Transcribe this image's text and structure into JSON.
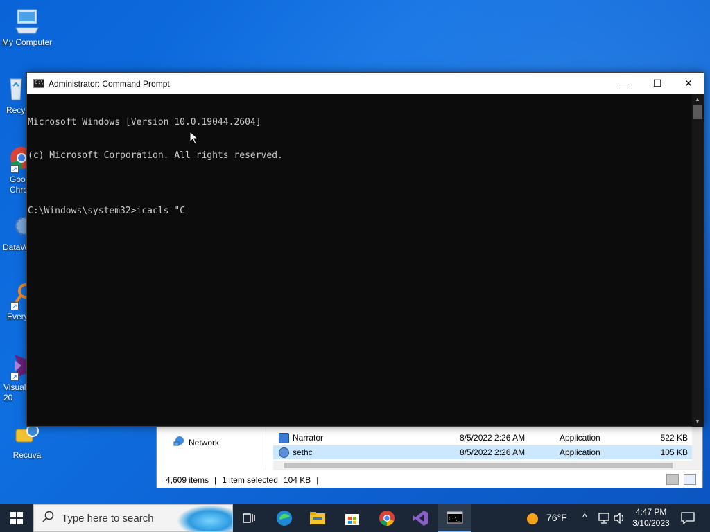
{
  "desktop": {
    "icons": [
      {
        "label": "My Computer"
      },
      {
        "label": "Recyc"
      },
      {
        "label": "Goo\nChro"
      },
      {
        "label": "DataW"
      },
      {
        "label": "Every"
      },
      {
        "label": "Visual\n20"
      },
      {
        "label": "Recuva"
      }
    ]
  },
  "cmd": {
    "title": "Administrator: Command Prompt",
    "lines": [
      "Microsoft Windows [Version 10.0.19044.2604]",
      "(c) Microsoft Corporation. All rights reserved.",
      "",
      "C:\\Windows\\system32>icacls \"C"
    ],
    "minimize_glyph": "—",
    "maximize_glyph": "☐",
    "close_glyph": "✕"
  },
  "explorer": {
    "nav_item": "Network",
    "files": [
      {
        "name": "Narrator",
        "date": "8/5/2022 2:26 AM",
        "type": "Application",
        "size": "522 KB",
        "icon": "narrator-icon"
      },
      {
        "name": "sethc",
        "date": "8/5/2022 2:26 AM",
        "type": "Application",
        "size": "105 KB",
        "icon": "gear-file-icon"
      }
    ],
    "status": {
      "items": "4,609 items",
      "selected": "1 item selected",
      "size": "104 KB"
    }
  },
  "taskbar": {
    "search_placeholder": "Type here to search",
    "weather": "76°F",
    "time": "4:47 PM",
    "date": "3/10/2023",
    "pinned": [
      "task-view-icon",
      "edge-icon",
      "file-explorer-icon",
      "store-icon",
      "chrome-icon",
      "visual-studio-icon",
      "cmd-icon"
    ]
  },
  "colors": {
    "desktop": "#0a64d8",
    "cmd_bg": "#0c0c0c",
    "cmd_text": "#cccccc",
    "taskbar": "#1b2736",
    "selection": "#cce8ff"
  }
}
